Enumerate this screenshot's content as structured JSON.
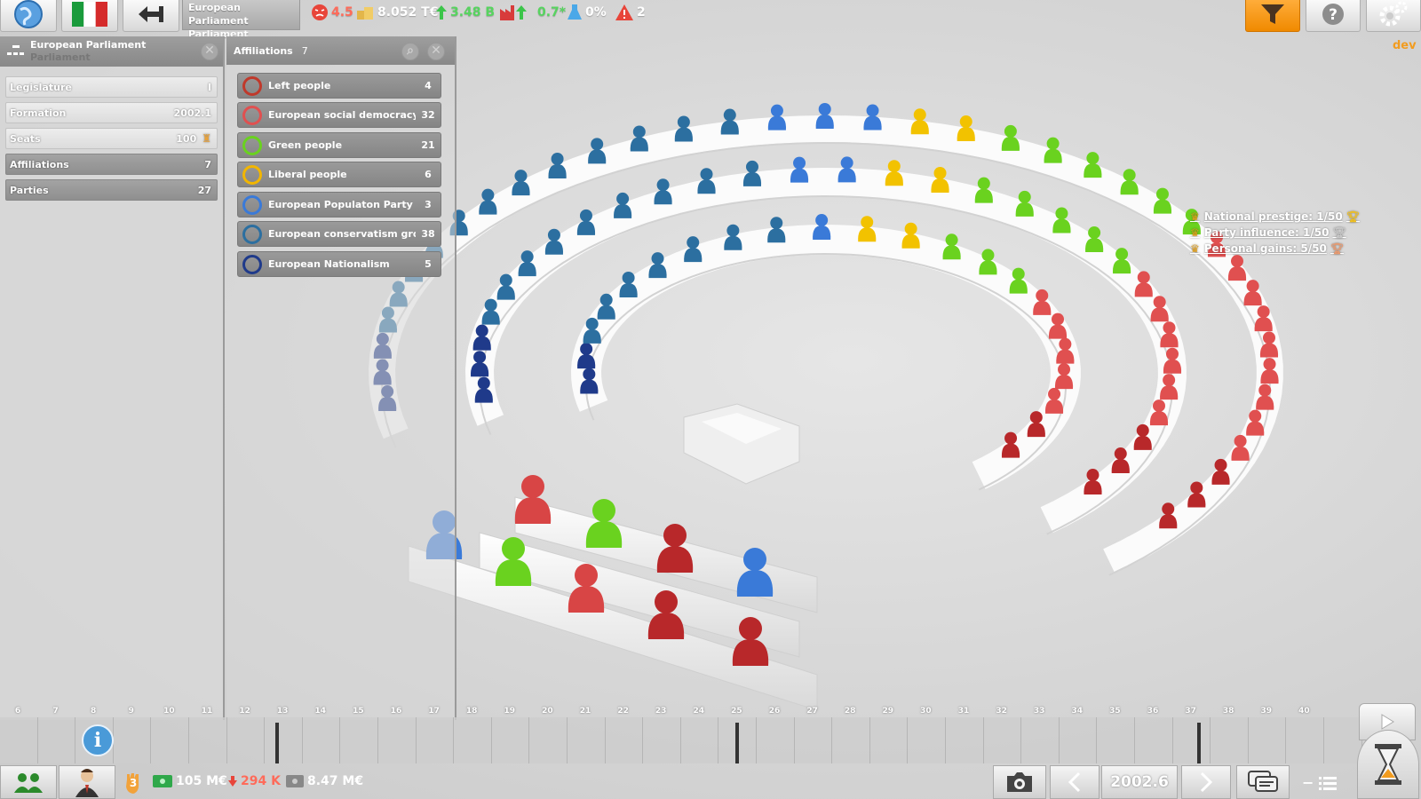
{
  "topbar": {
    "breadcrumb_title": "European Parliament",
    "breadcrumb_sub": "Parliament",
    "stats": {
      "unrest": "4.5",
      "treasury": "8.052 T€",
      "growth": "3.48 B",
      "industry": "0.7*",
      "research": "0%",
      "alerts": "2"
    },
    "dev_label": "dev"
  },
  "info_panel": {
    "title": "European Parliament",
    "subtitle": "Parliament",
    "rows": [
      {
        "label": "Legislature",
        "value": "I"
      },
      {
        "label": "Formation",
        "value": "2002.1"
      },
      {
        "label": "Seats",
        "value": "100"
      },
      {
        "label": "Affiliations",
        "value": "7"
      },
      {
        "label": "Parties",
        "value": "27"
      }
    ]
  },
  "affiliations_panel": {
    "title": "Affiliations",
    "count": "7",
    "items": [
      {
        "label": "Left people",
        "count": "4",
        "color": "#c0392b"
      },
      {
        "label": "European social democracy",
        "count": "32",
        "color": "#e05050"
      },
      {
        "label": "Green people",
        "count": "21",
        "color": "#6ad21f"
      },
      {
        "label": "Liberal people",
        "count": "6",
        "color": "#f2b600"
      },
      {
        "label": "European Populaton Party",
        "count": "3",
        "color": "#3a7ad8"
      },
      {
        "label": "European conservatism group",
        "count": "38",
        "color": "#2c6fa0"
      },
      {
        "label": "European Nationalism",
        "count": "5",
        "color": "#1f3a8a"
      }
    ]
  },
  "goals": [
    {
      "label": "National prestige: 1/50",
      "icon": "trophy-gold"
    },
    {
      "label": "Party influence: 1/50",
      "icon": "trophy-silver"
    },
    {
      "label": "Personal gains: 5/50",
      "icon": "trophy-bronze"
    }
  ],
  "timeline": {
    "numbers": [
      "6",
      "7",
      "8",
      "9",
      "10",
      "11",
      "12",
      "13",
      "14",
      "15",
      "16",
      "17",
      "18",
      "19",
      "20",
      "21",
      "22",
      "23",
      "24",
      "25",
      "26",
      "27",
      "28",
      "29",
      "30",
      "31",
      "32",
      "33",
      "34",
      "35",
      "36",
      "37",
      "38",
      "39",
      "40"
    ]
  },
  "bottombar": {
    "badge": "3",
    "money": "105 M€",
    "loss": "294 K",
    "cash": "8.47 M€",
    "date": "2002.6"
  }
}
